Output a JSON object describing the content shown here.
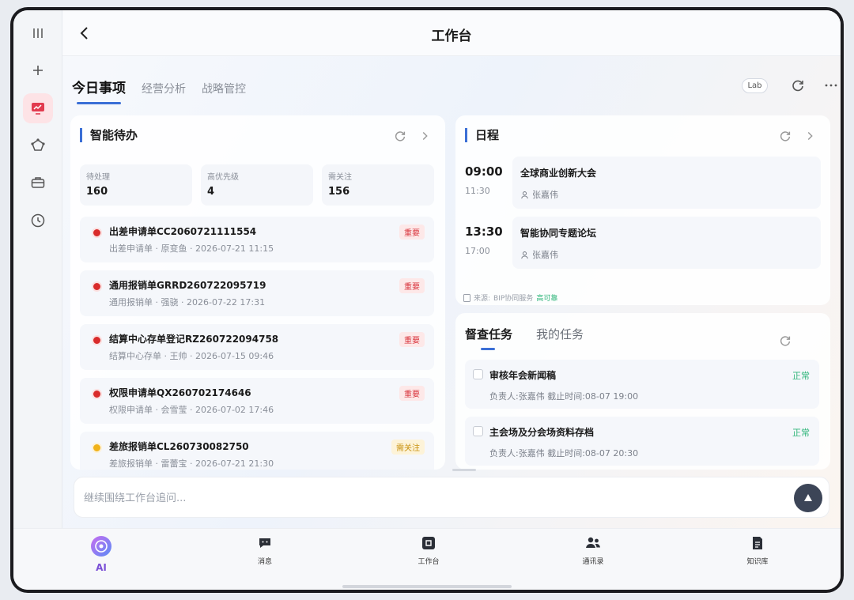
{
  "header": {
    "title": "工作台"
  },
  "tabs": [
    {
      "label": "今日事项",
      "active": true
    },
    {
      "label": "经营分析",
      "active": false
    },
    {
      "label": "战略管控",
      "active": false
    }
  ],
  "lab_label": "Lab",
  "todo_card": {
    "title": "智能待办",
    "stats": [
      {
        "label": "待处理",
        "value": "160"
      },
      {
        "label": "高优先级",
        "value": "4"
      },
      {
        "label": "需关注",
        "value": "156"
      }
    ],
    "items": [
      {
        "name": "出差申请单CC2060721111554",
        "meta": "出差申请单 · 原变鱼 · 2026-07-21 11:15",
        "badge": "重要",
        "level": "red"
      },
      {
        "name": "通用报销单GRRD260722095719",
        "meta": "通用报销单 · 强骁 · 2026-07-22 17:31",
        "badge": "重要",
        "level": "red"
      },
      {
        "name": "结算中心存单登记RZ260722094758",
        "meta": "结算中心存单 · 王帅 · 2026-07-15 09:46",
        "badge": "重要",
        "level": "red"
      },
      {
        "name": "权限申请单QX260702174646",
        "meta": "权限申请单 · 会雪莹 · 2026-07-02 17:46",
        "badge": "重要",
        "level": "red"
      },
      {
        "name": "差旅报销单CL260730082750",
        "meta": "差旅报销单 · 雷蕾宝 · 2026-07-21 21:30",
        "badge": "需关注",
        "level": "yellow"
      }
    ]
  },
  "schedule_card": {
    "title": "日程",
    "events": [
      {
        "start": "09:00",
        "end": "11:30",
        "name": "全球商业创新大会",
        "person": "张嘉伟"
      },
      {
        "start": "13:30",
        "end": "17:00",
        "name": "智能协同专题论坛",
        "person": "张嘉伟"
      }
    ],
    "source_label": "来源:",
    "source_name": "BIP协同服务",
    "source_status": "高可靠"
  },
  "task_card": {
    "tabs": [
      {
        "label": "督查任务",
        "active": true
      },
      {
        "label": "我的任务",
        "active": false
      }
    ],
    "items": [
      {
        "name": "审核年会新闻稿",
        "meta": "负责人:张嘉伟    截止时间:08-07 19:00",
        "status": "正常"
      },
      {
        "name": "主会场及分会场资料存档",
        "meta": "负责人:张嘉伟    截止时间:08-07 20:30",
        "status": "正常"
      }
    ]
  },
  "ask": {
    "placeholder": "继续围绕工作台追问..."
  },
  "bottom_nav": [
    {
      "label": "AI",
      "icon": "ai-orb-icon",
      "active": true
    },
    {
      "label": "消息",
      "icon": "message-icon",
      "active": false
    },
    {
      "label": "工作台",
      "icon": "workbench-icon",
      "active": false
    },
    {
      "label": "通讯录",
      "icon": "contacts-icon",
      "active": false
    },
    {
      "label": "知识库",
      "icon": "knowledge-icon",
      "active": false
    }
  ],
  "colors": {
    "accent": "#3b6fd6",
    "danger": "#d9363e",
    "warn": "#c8900c",
    "ok": "#2fb57a",
    "ai": "#7a4fd6"
  }
}
